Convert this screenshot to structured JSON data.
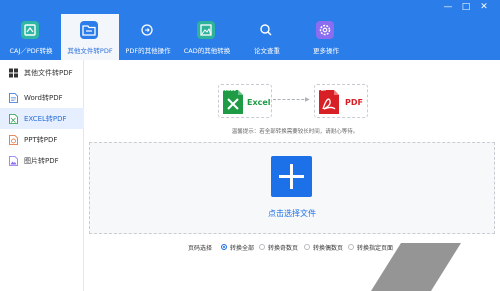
{
  "window": {
    "buttons": [
      "✕",
      "□",
      "—"
    ]
  },
  "toolbar": {
    "items": [
      {
        "label": "CAJ／PDF转换",
        "color": "#2fb6a4"
      },
      {
        "label": "其他文件转PDF",
        "color": "#2b7de9"
      },
      {
        "label": "PDF的其他操作",
        "color": "#2b7de9"
      },
      {
        "label": "CAD的其他转换",
        "color": "#2fb29b"
      },
      {
        "label": "论文查重",
        "color": "#2b7de9"
      },
      {
        "label": "更多操作",
        "color": "#8a6df0"
      }
    ]
  },
  "sidebar": {
    "items": [
      {
        "label": "其他文件转PDF",
        "icon": "grid-icon"
      },
      {
        "label": "Word转PDF",
        "icon": "word-doc-icon"
      },
      {
        "label": "EXCEL转PDF",
        "icon": "excel-doc-icon"
      },
      {
        "label": "PPT转PDF",
        "icon": "ppt-doc-icon"
      },
      {
        "label": "图片转PDF",
        "icon": "image-doc-icon"
      }
    ]
  },
  "conversion": {
    "source_tag": "EXCEL",
    "source_label": "Excel",
    "target_tag": "PDF",
    "target_label": "PDF",
    "source_color": "#1f9a45",
    "target_color": "#d81f26"
  },
  "hint": "温馨提示：若全部转换需要较长时间，请耐心等待。",
  "upload": {
    "label": "点击选择文件"
  },
  "page_options": {
    "label": "页码选择",
    "choices": [
      {
        "label": "转换全部",
        "checked": true
      },
      {
        "label": "转换奇数页",
        "checked": false
      },
      {
        "label": "转换偶数页",
        "checked": false
      },
      {
        "label": "转换指定页面",
        "checked": false
      }
    ]
  }
}
